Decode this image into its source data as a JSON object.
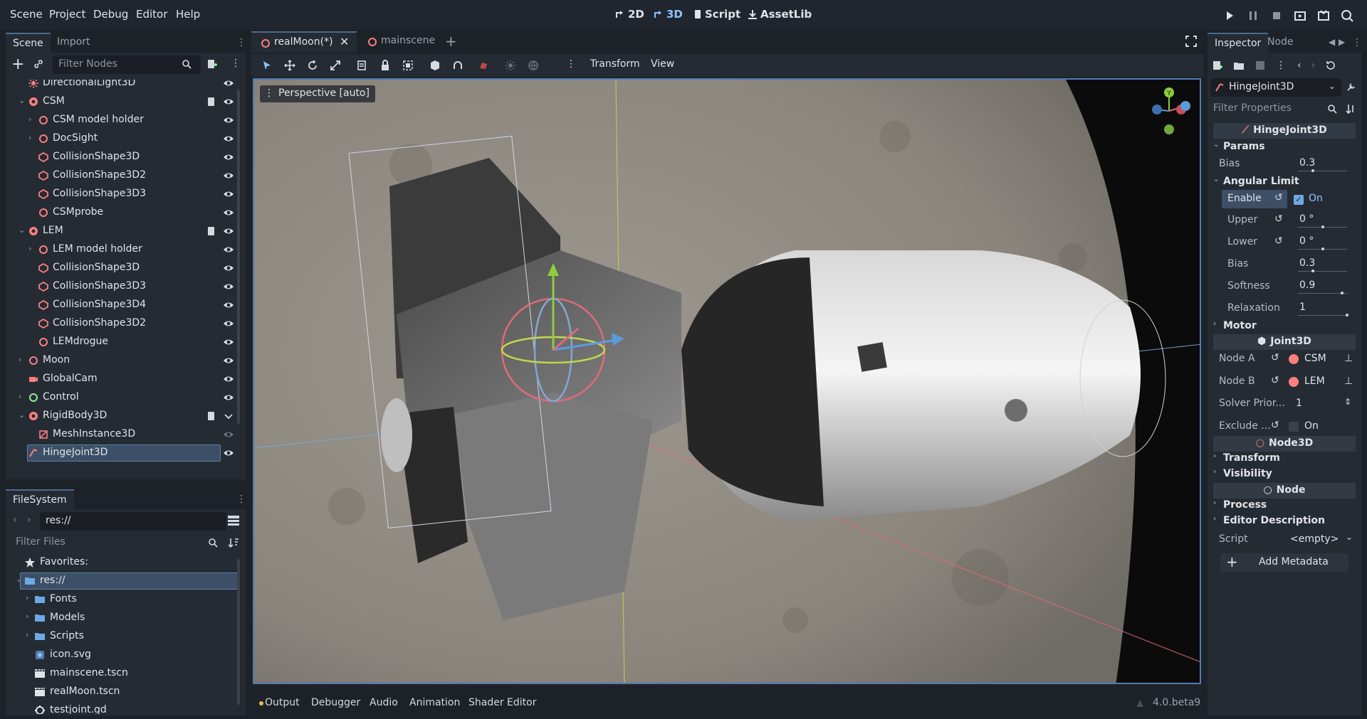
{
  "menu": [
    "Scene",
    "Project",
    "Debug",
    "Editor",
    "Help"
  ],
  "workspaces": {
    "two_d": "2D",
    "three_d": "3D",
    "script": "Script",
    "assetlib": "AssetLib"
  },
  "scene_dock": {
    "tabs": [
      "Scene",
      "Import"
    ],
    "filter_placeholder": "Filter Nodes",
    "nodes": [
      {
        "label": "DirectionalLight3D",
        "icon": "directional-light-icon"
      },
      {
        "label": "CSM",
        "icon": "rigidbody-icon"
      },
      {
        "label": "CSM model holder",
        "icon": "node3d-icon"
      },
      {
        "label": "DocSight",
        "icon": "node3d-icon"
      },
      {
        "label": "CollisionShape3D",
        "icon": "collision-shape-icon"
      },
      {
        "label": "CollisionShape3D2",
        "icon": "collision-shape-icon"
      },
      {
        "label": "CollisionShape3D3",
        "icon": "collision-shape-icon"
      },
      {
        "label": "CSMprobe",
        "icon": "node3d-icon"
      },
      {
        "label": "LEM",
        "icon": "rigidbody-icon"
      },
      {
        "label": "LEM model holder",
        "icon": "node3d-icon"
      },
      {
        "label": "CollisionShape3D",
        "icon": "collision-shape-icon"
      },
      {
        "label": "CollisionShape3D3",
        "icon": "collision-shape-icon"
      },
      {
        "label": "CollisionShape3D4",
        "icon": "collision-shape-icon"
      },
      {
        "label": "CollisionShape3D2",
        "icon": "collision-shape-icon"
      },
      {
        "label": "LEMdrogue",
        "icon": "node3d-icon"
      },
      {
        "label": "Moon",
        "icon": "node3d-icon"
      },
      {
        "label": "GlobalCam",
        "icon": "camera-icon"
      },
      {
        "label": "Control",
        "icon": "control-icon"
      },
      {
        "label": "RigidBody3D",
        "icon": "rigidbody-icon"
      },
      {
        "label": "MeshInstance3D",
        "icon": "mesh-icon"
      },
      {
        "label": "HingeJoint3D",
        "icon": "hinge-joint-icon"
      }
    ]
  },
  "filesystem": {
    "tab": "FileSystem",
    "path": "res://",
    "filter_placeholder": "Filter Files",
    "items": [
      {
        "label": "Favorites:",
        "icon": "star-icon"
      },
      {
        "label": "res://",
        "icon": "folder-icon"
      },
      {
        "label": "Fonts",
        "icon": "folder-icon"
      },
      {
        "label": "Models",
        "icon": "folder-icon"
      },
      {
        "label": "Scripts",
        "icon": "folder-icon"
      },
      {
        "label": "icon.svg",
        "icon": "image-file-icon"
      },
      {
        "label": "mainscene.tscn",
        "icon": "scene-file-icon"
      },
      {
        "label": "realMoon.tscn",
        "icon": "scene-file-icon"
      },
      {
        "label": "testjoint.gd",
        "icon": "script-file-icon"
      }
    ]
  },
  "editor_tabs": {
    "tabs": [
      "realMoon(*)",
      "mainscene"
    ]
  },
  "viewport_toolbar": {
    "transform": "Transform",
    "view": "View",
    "perspective": "Perspective [auto]"
  },
  "gizmo": {
    "y": "Y"
  },
  "inspector": {
    "tabs": [
      "Inspector",
      "Node"
    ],
    "object": "HingeJoint3D",
    "filter_placeholder": "Filter Properties",
    "class_header": "HingeJoint3D",
    "params": {
      "title": "Params",
      "bias_label": "Bias",
      "bias_value": "0.3",
      "bias_fraction": 0.3
    },
    "angular_limit": {
      "title": "Angular Limit",
      "enable_label": "Enable",
      "enable_value": "On",
      "upper_label": "Upper",
      "upper_value": "0 °",
      "lower_label": "Lower",
      "lower_value": "0 °",
      "bias_label": "Bias",
      "bias_value": "0.3",
      "softness_label": "Softness",
      "softness_value": "0.9",
      "relaxation_label": "Relaxation",
      "relaxation_value": "1",
      "upper_fraction": 0.5,
      "lower_fraction": 0.5,
      "bias_fraction": 0.3,
      "softness_fraction": 0.9,
      "relaxation_fraction": 1.0
    },
    "motor": "Motor",
    "joint3d_header": "Joint3D",
    "node_a_label": "Node A",
    "node_a_value": "CSM",
    "node_b_label": "Node B",
    "node_b_value": "LEM",
    "solver_label": "Solver Prior...",
    "solver_value": "1",
    "exclude_label": "Exclude ...",
    "exclude_value": "On",
    "node3d_header": "Node3D",
    "transform": "Transform",
    "visibility": "Visibility",
    "node_header": "Node",
    "process": "Process",
    "editor_description": "Editor Description",
    "script_label": "Script",
    "script_value": "<empty>",
    "add_metadata": "Add Metadata"
  },
  "bottom_panel": {
    "tabs": [
      "Output",
      "Debugger",
      "Audio",
      "Animation",
      "Shader Editor"
    ],
    "version": "4.0.beta9"
  },
  "colors": {
    "accent": "#8fc2ff",
    "node_red": "#fc7f7f",
    "control_green": "#8eef97",
    "selection": "#3c4f66"
  }
}
